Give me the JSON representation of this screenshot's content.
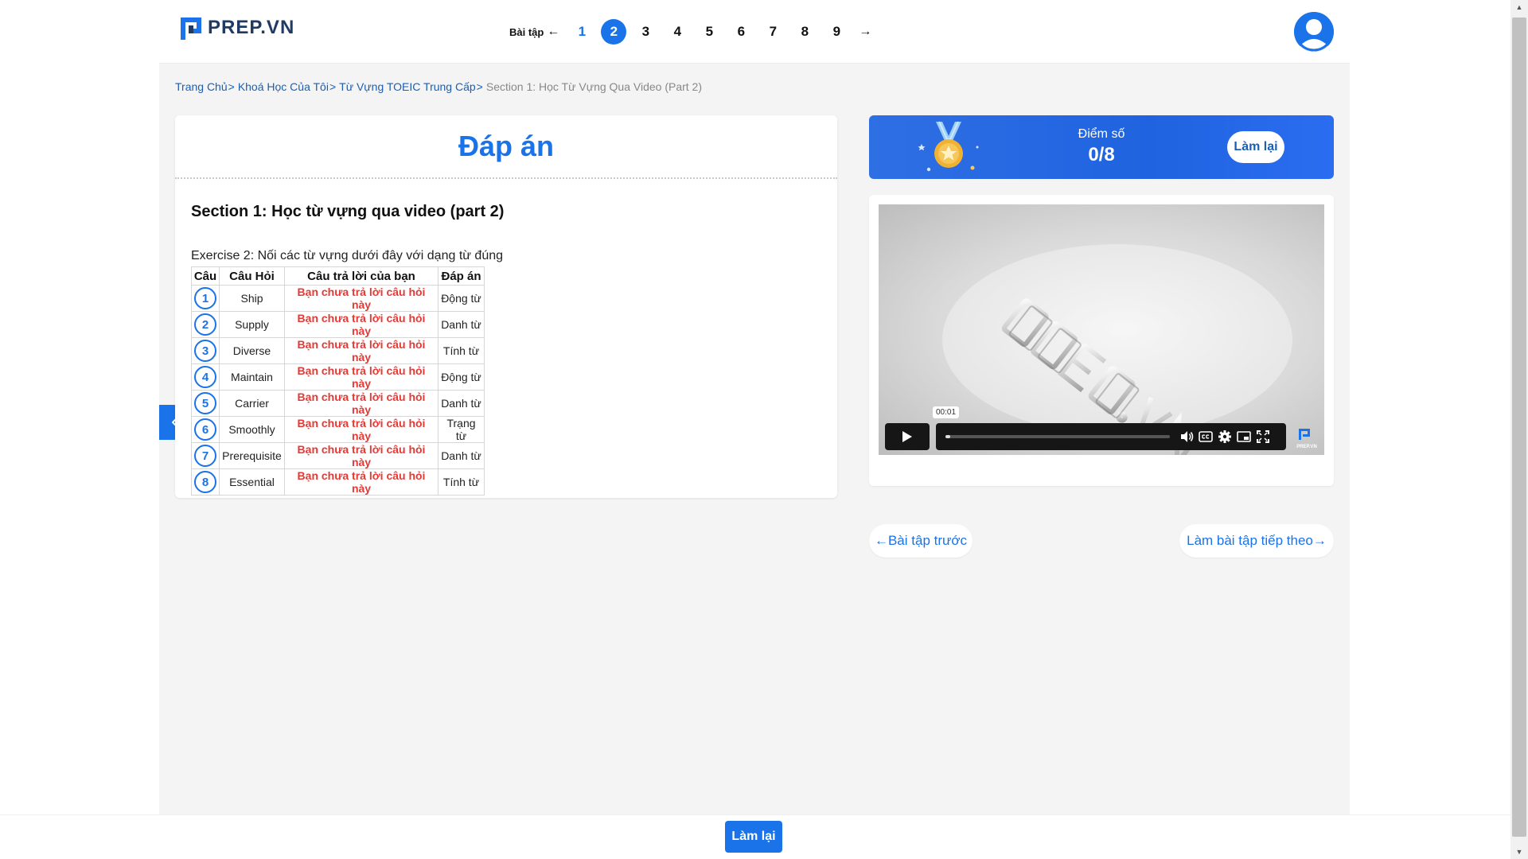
{
  "brand": {
    "name": "PREP.VN"
  },
  "exercise_nav": {
    "label": "Bài tập",
    "prev_arrow": "←",
    "next_arrow": "→",
    "items": [
      "1",
      "2",
      "3",
      "4",
      "5",
      "6",
      "7",
      "8",
      "9"
    ],
    "active": "2"
  },
  "breadcrumb": {
    "items": [
      "Trang Chủ",
      "Khoá Học Của Tôi",
      "Từ Vựng TOEIC Trung Cấp"
    ],
    "separator": ">",
    "current": "Section 1: Học Từ Vựng Qua Video (Part 2)"
  },
  "answer": {
    "title": "Đáp án",
    "section_title": "Section 1: Học từ vựng qua video (part 2)",
    "exercise_text": "Exercise 2: Nối các từ vựng dưới đây với dạng từ đúng",
    "columns": [
      "Câu",
      "Câu Hỏi",
      "Câu trả lời của bạn",
      "Đáp án"
    ],
    "rows": [
      {
        "num": "1",
        "word": "Ship",
        "user": "Bạn chưa trả lời câu hỏi này",
        "answer": "Động từ"
      },
      {
        "num": "2",
        "word": "Supply",
        "user": "Bạn chưa trả lời câu hỏi này",
        "answer": "Danh từ"
      },
      {
        "num": "3",
        "word": "Diverse",
        "user": "Bạn chưa trả lời câu hỏi này",
        "answer": "Tính từ"
      },
      {
        "num": "4",
        "word": "Maintain",
        "user": "Bạn chưa trả lời câu hỏi này",
        "answer": "Động từ"
      },
      {
        "num": "5",
        "word": "Carrier",
        "user": "Bạn chưa trả lời câu hỏi này",
        "answer": "Danh từ"
      },
      {
        "num": "6",
        "word": "Smoothly",
        "user": "Bạn chưa trả lời câu hỏi này",
        "answer": "Trạng từ"
      },
      {
        "num": "7",
        "word": "Prerequisite",
        "user": "Bạn chưa trả lời câu hỏi này",
        "answer": "Danh từ"
      },
      {
        "num": "8",
        "word": "Essential",
        "user": "Bạn chưa trả lời câu hỏi này",
        "answer": "Tính từ"
      }
    ]
  },
  "score": {
    "label": "Điểm số",
    "value": "0/8",
    "retry_label": "Làm lại"
  },
  "video": {
    "time": "00:01",
    "progress": 0.01,
    "watermark": "PREP.VN"
  },
  "navigation": {
    "prev_label": "←Bài tập trước",
    "next_label": "Làm bài tập tiếp theo→"
  },
  "footer": {
    "retry_label": "Làm lại"
  },
  "colors": {
    "primary": "#1a73e8",
    "error": "#e53935",
    "background": "#f4f4f5"
  }
}
